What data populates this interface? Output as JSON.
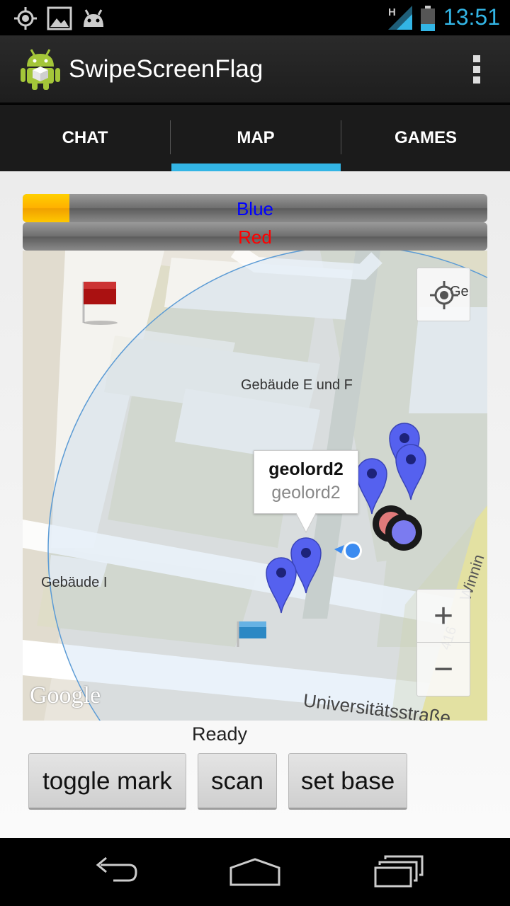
{
  "status_bar": {
    "time": "13:51",
    "icons": [
      "gps-icon",
      "picture-icon",
      "android-icon",
      "signal-icon",
      "battery-icon"
    ],
    "network": "H"
  },
  "app": {
    "title": "SwipeScreenFlag",
    "icon": "android-app-icon"
  },
  "tabs": [
    {
      "label": "CHAT",
      "selected": false
    },
    {
      "label": "MAP",
      "selected": true
    },
    {
      "label": "GAMES",
      "selected": false
    }
  ],
  "teams": {
    "blue": {
      "label": "Blue",
      "color": "#0000ff",
      "progress": 0.1
    },
    "red": {
      "label": "Red",
      "color": "#ff0000",
      "progress": 0.0
    }
  },
  "map": {
    "labels": {
      "building_ef": "Gebäude E und F",
      "building_i": "Gebäude I",
      "building_top": "Gebäude",
      "street": "Universitätsstraße",
      "street2": "Winnin",
      "road_number": "416"
    },
    "logo": "Google",
    "info_window": {
      "title": "geolord2",
      "subtitle": "geolord2"
    },
    "zoom_in": "+",
    "zoom_out": "−",
    "marker_color": "#5561ef",
    "flags": {
      "red": "#aa1111",
      "blue": "#2c88c4"
    }
  },
  "status_text": "Ready",
  "buttons": {
    "toggle_mark": "toggle mark",
    "scan": "scan",
    "set_base": "set base"
  },
  "navbar": [
    "back-icon",
    "home-icon",
    "recent-apps-icon"
  ]
}
